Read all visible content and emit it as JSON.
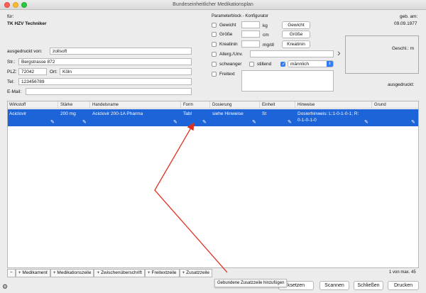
{
  "window": {
    "title": "Bundeseinheitlicher Medikationsplan"
  },
  "patient": {
    "fuer_label": "für:",
    "insurance": "TK HZV Techniker",
    "printed_by_label": "ausgedruckt von:",
    "printed_by_value": "zollsoft",
    "street_label": "Str.:",
    "street_value": "Bergstrasse 872",
    "plz_label": "PLZ:",
    "plz_value": "72042",
    "ort_label": "Ort:",
    "ort_value": "Köln",
    "tel_label": "Tel:",
    "tel_value": "123456789",
    "email_label": "E-Mail:",
    "email_value": ""
  },
  "params": {
    "title": "Parameterblock - Konfigurator",
    "gewicht_label": "Gewicht",
    "gewicht_unit": "kg",
    "gewicht_button": "Gewicht",
    "groesse_label": "Größe",
    "groesse_unit": "cm",
    "groesse_button": "Größe",
    "kreatinin_label": "Kreatinin",
    "kreatinin_unit": "mg/dl",
    "kreatinin_button": "Kreatinin",
    "allerg_label": "Allerg./Unv.",
    "schwanger_label": "schwanger",
    "stillend_label": "stillend",
    "sex_value": "männlich",
    "freitext_label": "Freitext"
  },
  "right": {
    "geb_label": "geb. am:",
    "geb_value": "09.09.1977",
    "geschl_label": "Geschl.: m",
    "ausgedruckt_label": "ausgedruckt:"
  },
  "table": {
    "columns": [
      "Wirkstoff",
      "Stärke",
      "Handelsname",
      "Form",
      "Dosierung",
      "Einheit",
      "Hinweise",
      "Grund"
    ],
    "rows": [
      {
        "wirkstoff": "Aciclovir",
        "staerke": "200 mg",
        "handelsname": "Aciclovir 200-1A Pharma",
        "form": "Tabl",
        "dosierung": "siehe Hinweise",
        "einheit": "St",
        "hinweise_1": "Dosierhinweis: L:1-0-1-0-1; R:",
        "hinweise_2": "0-1-0-1-0",
        "grund": ""
      }
    ],
    "count": "1 von max. 45"
  },
  "bottombar": {
    "minus": "−",
    "medikament": "+ Medikament",
    "medikationszeile": "+ Medikationszeile",
    "zwischenueberschrift": "+ Zwischenüberschrift",
    "freitextzeile": "+ Freitextzeile",
    "zusatzzeile": "+ Zusatzzeile"
  },
  "tooltip": "Gebundene Zusatzzeile hinzufügen",
  "actions": {
    "ersetzen": "ksetzen",
    "scannen": "Scannen",
    "schliessen": "Schließen",
    "drucken": "Drucken"
  },
  "colors": {
    "selection": "#1c64d8",
    "arrow": "#e0301e"
  }
}
